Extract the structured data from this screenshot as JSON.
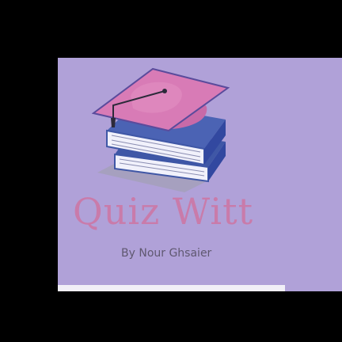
{
  "splash": {
    "title": "Quiz Witt",
    "author": "By Nour Ghsaier"
  },
  "logo": {
    "icon": "graduation-cap-on-books-icon"
  },
  "colors": {
    "background": "#000000",
    "card": "#b0a1d8",
    "title": "#c97baa",
    "author": "#5f5870",
    "book_cover": "#3f57a6",
    "cap": "#d87bb6"
  }
}
